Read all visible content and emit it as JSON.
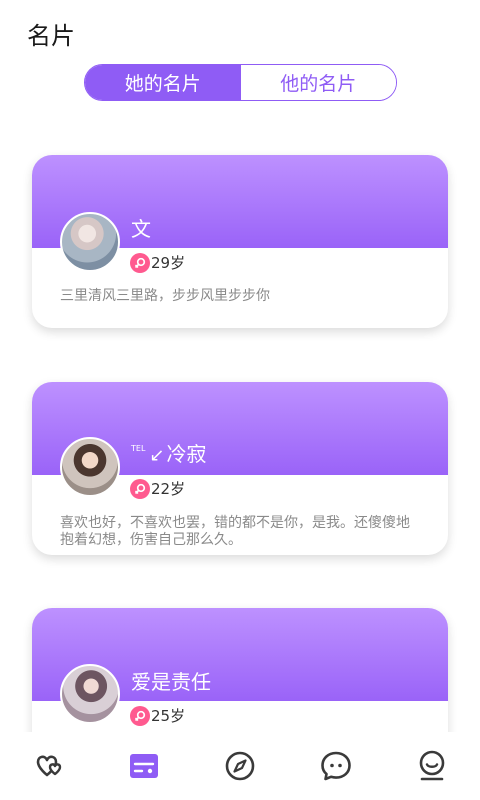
{
  "header": {
    "title": "名片"
  },
  "segment": {
    "tabs": [
      {
        "label": "她的名片",
        "active": true
      },
      {
        "label": "他的名片",
        "active": false
      }
    ]
  },
  "cards": [
    {
      "name": "文",
      "age": "29岁",
      "desc": "三里清风三里路，步步风里步步你"
    },
    {
      "tel_prefix": "TEL",
      "name": "冷寂",
      "age": "22岁",
      "desc": "喜欢也好，不喜欢也罢，错的都不是你，是我。还傻傻地抱着幻想，伤害自己那么久。"
    },
    {
      "name": "爱是责任",
      "age": "25岁",
      "desc": ""
    }
  ],
  "tabbar": {
    "items": [
      {
        "icon": "hearts-icon",
        "active": false
      },
      {
        "icon": "card-icon",
        "active": true
      },
      {
        "icon": "compass-icon",
        "active": false
      },
      {
        "icon": "chat-icon",
        "active": false
      },
      {
        "icon": "profile-icon",
        "active": false
      }
    ]
  },
  "colors": {
    "accent": "#8f5cf5",
    "header_top": "#bd91ff",
    "header_bottom": "#9a63f8",
    "female_badge": "#ff5a8f"
  }
}
